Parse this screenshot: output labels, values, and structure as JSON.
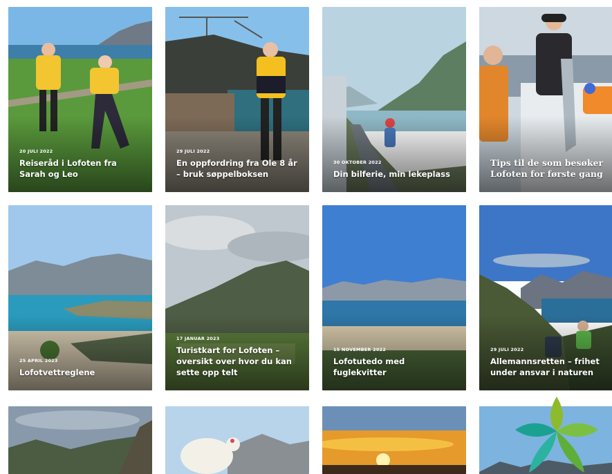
{
  "articles": [
    {
      "date": "20 JULI 2022",
      "title": "Reiseråd i Lofoten fra Sarah og Leo"
    },
    {
      "date": "29 JULI 2022",
      "title": "En oppfordring fra Ole 8 år – bruk søppelboksen"
    },
    {
      "date": "30 OKTOBER 2022",
      "title": "Din bilferie, min lekeplass"
    },
    {
      "date": "",
      "title": "Tips til de som besøker Lofoten for første gang"
    },
    {
      "date": "25 APRIL 2023",
      "title": "Lofotvettreglene"
    },
    {
      "date": "17 JANUAR 2023",
      "title": "Turistkart for Lofoten – oversikt over hvor du kan sette opp telt"
    },
    {
      "date": "15 NOVEMBER 2022",
      "title": "Lofotutedo med fuglekvitter"
    },
    {
      "date": "29 JULI 2022",
      "title": "Allemannsretten – frihet under ansvar i naturen"
    },
    {
      "date": "",
      "title": ""
    },
    {
      "date": "",
      "title": ""
    },
    {
      "date": "",
      "title": ""
    },
    {
      "date": "",
      "title": ""
    }
  ],
  "colors": {
    "sky": "#5b9fd8",
    "sea": "#2f8fb5",
    "grass": "#4f8a3a",
    "mountain": "#5b6f63",
    "logo_green": "#8dbb2c",
    "logo_teal": "#1aa192"
  }
}
